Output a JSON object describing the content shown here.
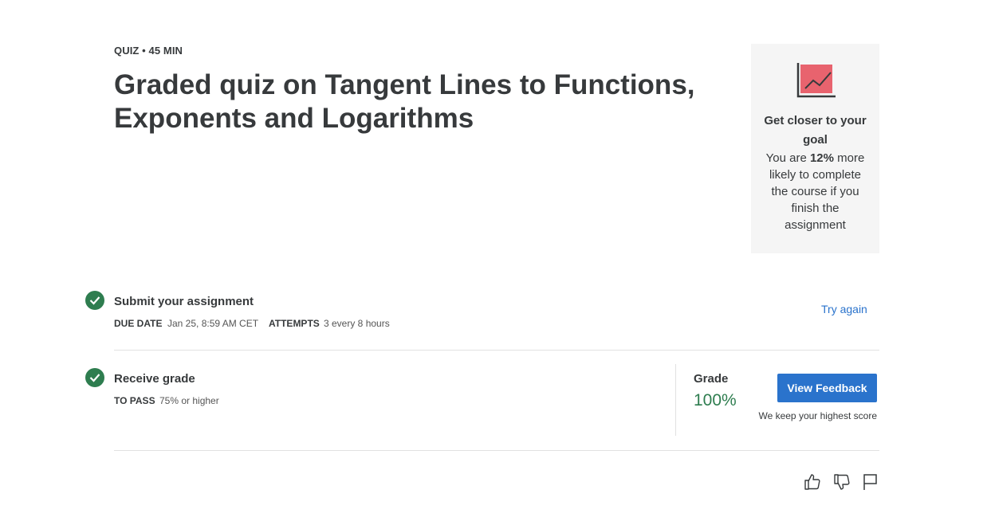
{
  "header": {
    "meta": "QUIZ • 45 MIN",
    "title": "Graded quiz on Tangent Lines to Functions, Exponents and Logarithms"
  },
  "goal_card": {
    "icon": "trend-chart-icon",
    "heading": "Get closer to your goal",
    "text_before": "You are ",
    "highlight": "12%",
    "text_after": " more likely to complete the course if you finish the assignment"
  },
  "submit": {
    "title": "Submit your assignment",
    "due_label": "DUE DATE",
    "due_value": "Jan 25, 8:59 AM CET",
    "attempts_label": "ATTEMPTS",
    "attempts_value": "3 every 8 hours",
    "try_again": "Try again"
  },
  "receive": {
    "title": "Receive grade",
    "pass_label": "TO PASS",
    "pass_value": "75% or higher",
    "grade_label": "Grade",
    "grade_value": "100%",
    "feedback_button": "View Feedback",
    "note": "We keep your highest score"
  },
  "colors": {
    "accent": "#2a73cc",
    "success": "#2e7d4f",
    "card_bg": "#f5f5f5",
    "chart_fill": "#e8636e"
  },
  "footer": {
    "icons": [
      "thumbs-up-icon",
      "thumbs-down-icon",
      "flag-icon"
    ]
  }
}
